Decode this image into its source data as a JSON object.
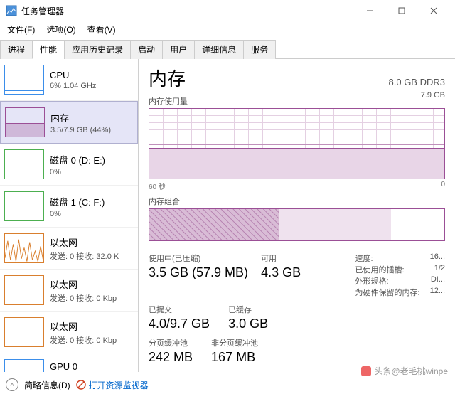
{
  "window": {
    "title": "任务管理器",
    "minimize": "—",
    "maximize": "□",
    "close": "✕"
  },
  "menu": {
    "file": "文件(F)",
    "options": "选项(O)",
    "view": "查看(V)"
  },
  "tabs": {
    "processes": "进程",
    "performance": "性能",
    "history": "应用历史记录",
    "startup": "启动",
    "users": "用户",
    "details": "详细信息",
    "services": "服务"
  },
  "sidebar": {
    "cpu": {
      "title": "CPU",
      "sub": "6% 1.04 GHz"
    },
    "mem": {
      "title": "内存",
      "sub": "3.5/7.9 GB (44%)"
    },
    "disk0": {
      "title": "磁盘 0 (D: E:)",
      "sub": "0%"
    },
    "disk1": {
      "title": "磁盘 1 (C: F:)",
      "sub": "0%"
    },
    "eth0": {
      "title": "以太网",
      "sub": "发送: 0 接收: 32.0 K"
    },
    "eth1": {
      "title": "以太网",
      "sub": "发送: 0 接收: 0 Kbp"
    },
    "eth2": {
      "title": "以太网",
      "sub": "发送: 0 接收: 0 Kbp"
    },
    "gpu": {
      "title": "GPU 0",
      "sub": ""
    }
  },
  "main": {
    "title": "内存",
    "spec": "8.0 GB DDR3",
    "usage_label": "内存使用量",
    "usage_max": "7.9 GB",
    "axis_left": "60 秒",
    "axis_right": "0",
    "comp_label": "内存组合",
    "stats": {
      "inuse_label": "使用中(已压缩)",
      "inuse_val": "3.5 GB (57.9 MB)",
      "avail_label": "可用",
      "avail_val": "4.3 GB",
      "commit_label": "已提交",
      "commit_val": "4.0/9.7 GB",
      "cached_label": "已缓存",
      "cached_val": "3.0 GB",
      "paged_label": "分页缓冲池",
      "paged_val": "242 MB",
      "nonpaged_label": "非分页缓冲池",
      "nonpaged_val": "167 MB"
    },
    "right": {
      "speed_label": "速度:",
      "speed_val": "16...",
      "slots_label": "已使用的插槽:",
      "slots_val": "1/2",
      "form_label": "外形规格:",
      "form_val": "DI...",
      "reserved_label": "为硬件保留的内存:",
      "reserved_val": "12..."
    }
  },
  "footer": {
    "fewer": "简略信息(D)",
    "resmon": "打开资源监视器"
  },
  "watermark": "头条@老毛桃winpe"
}
